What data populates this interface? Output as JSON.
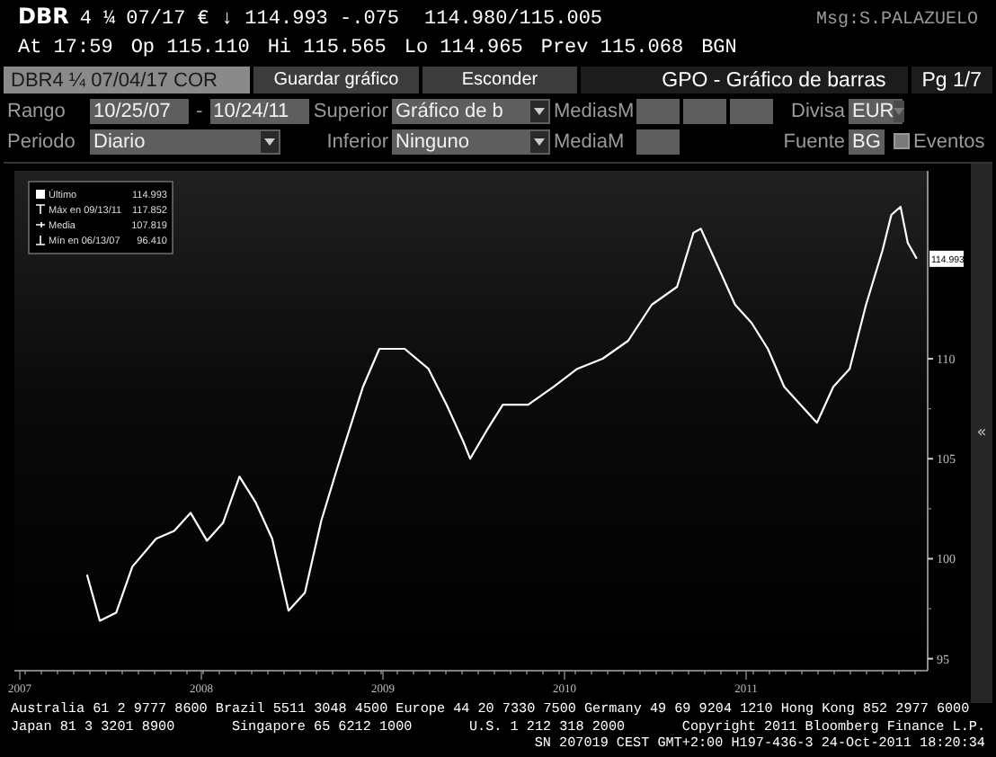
{
  "quote": {
    "ticker": "DBR",
    "coupon": "4 ¼",
    "line": "07/17 € ↓ 114.993 -.075",
    "bid_ask": "114.980/115.005",
    "message": "Msg:S.PALAZUELO"
  },
  "stats": [
    "At 17:59",
    "Op 115.110",
    "Hi 115.565",
    "Lo 114.965",
    "Prev 115.068",
    "BGN"
  ],
  "toolbar": {
    "security": "DBR4 ¼ 07/04/17 COR",
    "buttons": [
      "Guardar gráfico",
      "Esconder"
    ],
    "title": "GPO - Gráfico de barras",
    "page": "Pg 1/7"
  },
  "settings": [
    [
      [
        {
          "kind": "label",
          "text": "Rango"
        }
      ],
      [
        {
          "kind": "field",
          "value": "10/25/07"
        },
        {
          "kind": "label",
          "text": "-"
        },
        {
          "kind": "field",
          "value": "10/24/11"
        }
      ],
      [
        {
          "kind": "label",
          "text": "Superior"
        }
      ],
      [
        {
          "kind": "dropdown",
          "value": "Gráfico de b",
          "disabled": false
        }
      ],
      [
        {
          "kind": "label",
          "text": "MediasM"
        }
      ],
      [
        {
          "kind": "field"
        },
        {
          "kind": "field"
        },
        {
          "kind": "field"
        }
      ],
      [
        {
          "kind": "label",
          "text": "Divisa"
        }
      ],
      [
        {
          "kind": "dropdown",
          "value": "EUR",
          "disabled": true
        }
      ]
    ],
    [
      [
        {
          "kind": "label",
          "text": "Periodo"
        }
      ],
      [
        {
          "kind": "dropdown",
          "value": "Diario",
          "disabled": false
        }
      ],
      [
        {
          "kind": "label",
          "text": "Inferior"
        }
      ],
      [
        {
          "kind": "dropdown",
          "value": "Ninguno",
          "disabled": false
        }
      ],
      [
        {
          "kind": "label",
          "text": "MediaM"
        }
      ],
      [
        {
          "kind": "field"
        }
      ],
      [
        {
          "kind": "label",
          "text": "Fuente"
        }
      ],
      [
        {
          "kind": "field",
          "value": "BG"
        },
        {
          "kind": "checkbox",
          "label": "Eventos",
          "checked": false
        }
      ]
    ]
  ],
  "chart": {
    "legend": [
      {
        "kind": "last",
        "label": "Último",
        "value": "114.993"
      },
      {
        "kind": "max",
        "label": "Máx en 09/13/11",
        "value": "117.852"
      },
      {
        "kind": "mean",
        "label": "Media",
        "value": "107.819"
      },
      {
        "kind": "min",
        "label": "Mín en 06/13/07",
        "value": "96.410"
      }
    ],
    "price_tag": "114.993",
    "collapse": "«",
    "chart_data": {
      "type": "line",
      "xlim": [
        2006.97,
        2012.0
      ],
      "ylim": [
        94.4,
        119.4
      ],
      "yticks": [
        95,
        100,
        105,
        110
      ],
      "xticks": [
        2007,
        2008,
        2009,
        2010,
        2011
      ],
      "x": [
        2007.37,
        2007.44,
        2007.53,
        2007.62,
        2007.75,
        2007.85,
        2007.94,
        2008.03,
        2008.12,
        2008.21,
        2008.3,
        2008.39,
        2008.48,
        2008.57,
        2008.66,
        2008.75,
        2008.89,
        2008.98,
        2009.12,
        2009.25,
        2009.35,
        2009.44,
        2009.48,
        2009.57,
        2009.66,
        2009.8,
        2009.94,
        2010.07,
        2010.21,
        2010.35,
        2010.48,
        2010.62,
        2010.71,
        2010.75,
        2010.85,
        2010.94,
        2011.03,
        2011.12,
        2011.21,
        2011.3,
        2011.39,
        2011.48,
        2011.57,
        2011.66,
        2011.75,
        2011.8,
        2011.85,
        2011.89,
        2011.94
      ],
      "series": [
        {
          "color": "#ffffff",
          "values": [
            99.2,
            96.9,
            97.3,
            99.6,
            101.0,
            101.4,
            102.3,
            100.9,
            101.8,
            104.1,
            102.8,
            101.0,
            97.4,
            98.3,
            101.9,
            104.6,
            108.6,
            110.5,
            110.5,
            109.5,
            107.7,
            105.9,
            105.0,
            106.4,
            107.7,
            107.7,
            108.6,
            109.5,
            110.0,
            110.9,
            112.7,
            113.6,
            116.3,
            116.5,
            114.5,
            112.7,
            111.8,
            110.5,
            108.6,
            107.7,
            106.8,
            108.6,
            109.5,
            112.7,
            115.4,
            117.2,
            117.6,
            115.8,
            115.0
          ]
        }
      ]
    }
  },
  "footer": {
    "line_1": "Australia 61 2 9777 8600 Brazil 5511 3048 4500 Europe 44 20 7330 7500 Germany 49 69 9204 1210 Hong Kong 852 2977 6000",
    "line_2": [
      "Japan 81 3 3201 8900",
      "Singapore 65 6212 1000",
      "U.S. 1 212 318 2000",
      "Copyright 2011 Bloomberg Finance L.P."
    ],
    "line_3": "SN 207019 CEST GMT+2:00 H197-436-3 24-Oct-2011 18:20:34"
  }
}
